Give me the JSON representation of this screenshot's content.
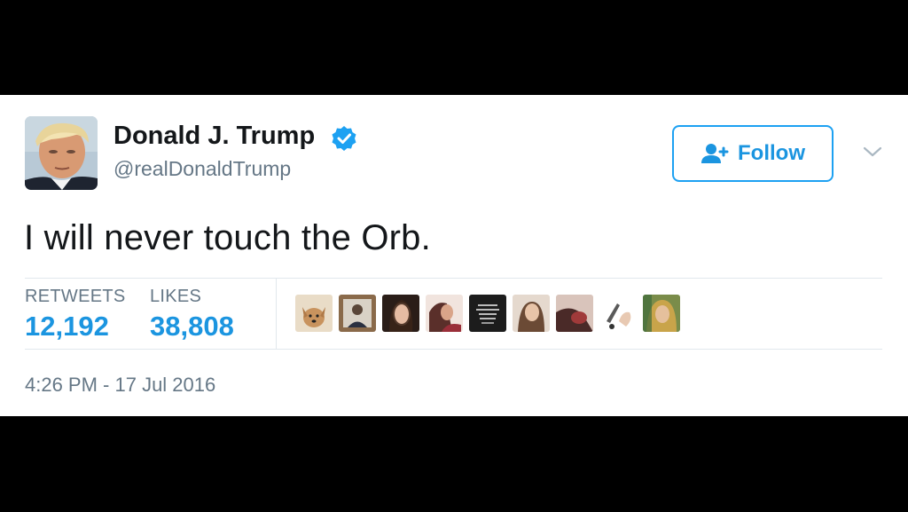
{
  "tweet": {
    "author": {
      "display_name": "Donald J. Trump",
      "handle": "@realDonaldTrump",
      "verified": true
    },
    "follow_label": "Follow",
    "text": "I will never touch the Orb.",
    "stats": {
      "retweets_label": "RETWEETS",
      "retweets_value": "12,192",
      "likes_label": "LIKES",
      "likes_value": "38,808"
    },
    "timestamp": "4:26 PM - 17 Jul 2016"
  },
  "colors": {
    "accent": "#1b95e0",
    "text": "#14171a",
    "muted": "#657786",
    "divider": "#e1e8ed",
    "letterbox": "#000000"
  },
  "icons": {
    "verified": "verified-badge-icon",
    "follow": "add-user-icon",
    "menu": "chevron-down-icon"
  }
}
